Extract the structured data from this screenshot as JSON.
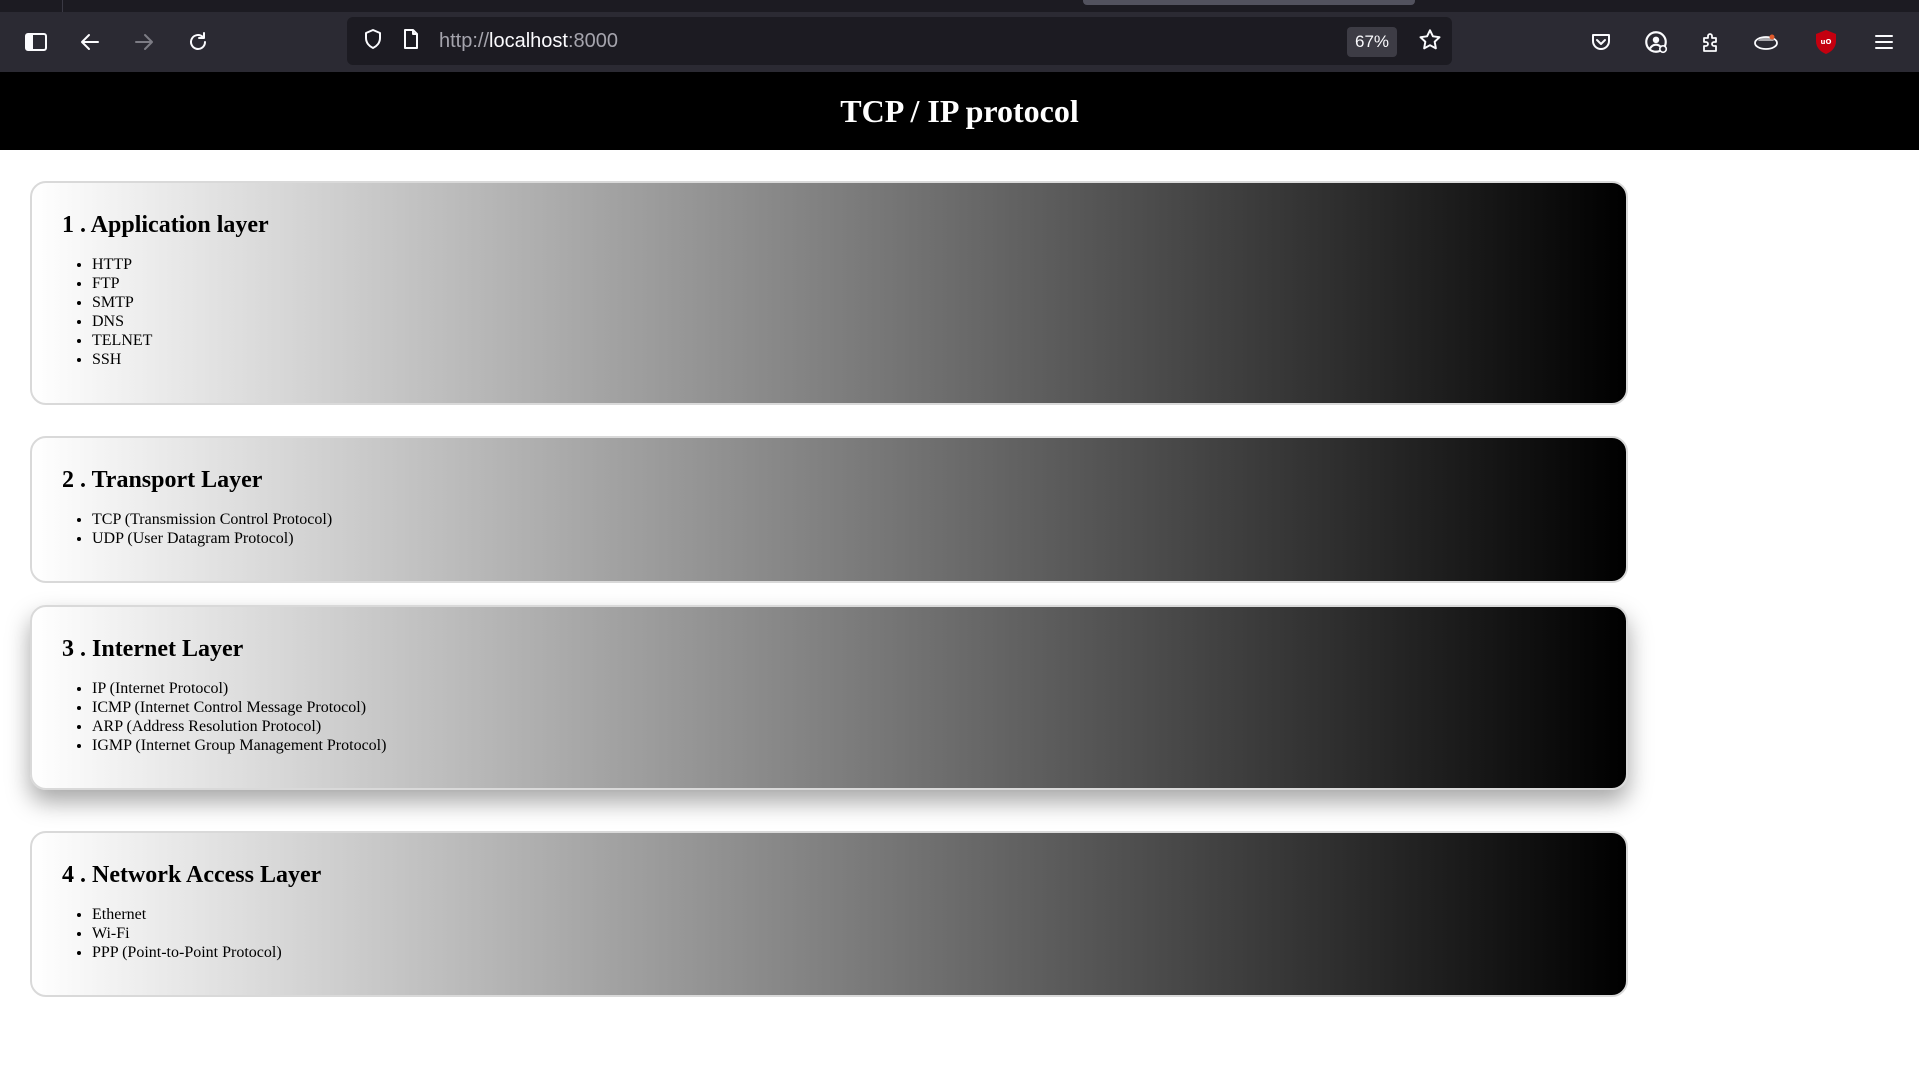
{
  "browser": {
    "url_scheme": "http://",
    "url_host": "localhost",
    "url_port": ":8000",
    "zoom": "67%"
  },
  "page": {
    "title": "TCP / IP protocol"
  },
  "layers": [
    {
      "title": "1 . Application layer",
      "items": [
        "HTTP",
        "FTP",
        "SMTP",
        "DNS",
        "TELNET",
        "SSH"
      ]
    },
    {
      "title": "2 . Transport Layer",
      "items": [
        "TCP (Transmission Control Protocol)",
        "UDP (User Datagram Protocol)"
      ]
    },
    {
      "title": "3 . Internet Layer",
      "items": [
        "IP (Internet Protocol)",
        "ICMP (Internet Control Message Protocol)",
        "ARP (Address Resolution Protocol)",
        "IGMP (Internet Group Management Protocol)"
      ]
    },
    {
      "title": "4 . Network Access Layer",
      "items": [
        "Ethernet",
        "Wi-Fi",
        "PPP (Point-to-Point Protocol)"
      ]
    }
  ],
  "colors": {
    "chrome_bg": "#2b2a33",
    "url_bg": "#1c1b22",
    "header_bg": "#000000",
    "card_gradient_start": "#ffffff",
    "card_gradient_end": "#000000",
    "ublock_red": "#c4000f"
  },
  "icons": [
    "sidebar-icon",
    "back-icon",
    "forward-icon",
    "reload-icon",
    "shield-icon",
    "page-icon",
    "star-icon",
    "pocket-icon",
    "account-icon",
    "extensions-icon",
    "extension-icon",
    "ublock-icon",
    "menu-icon"
  ]
}
